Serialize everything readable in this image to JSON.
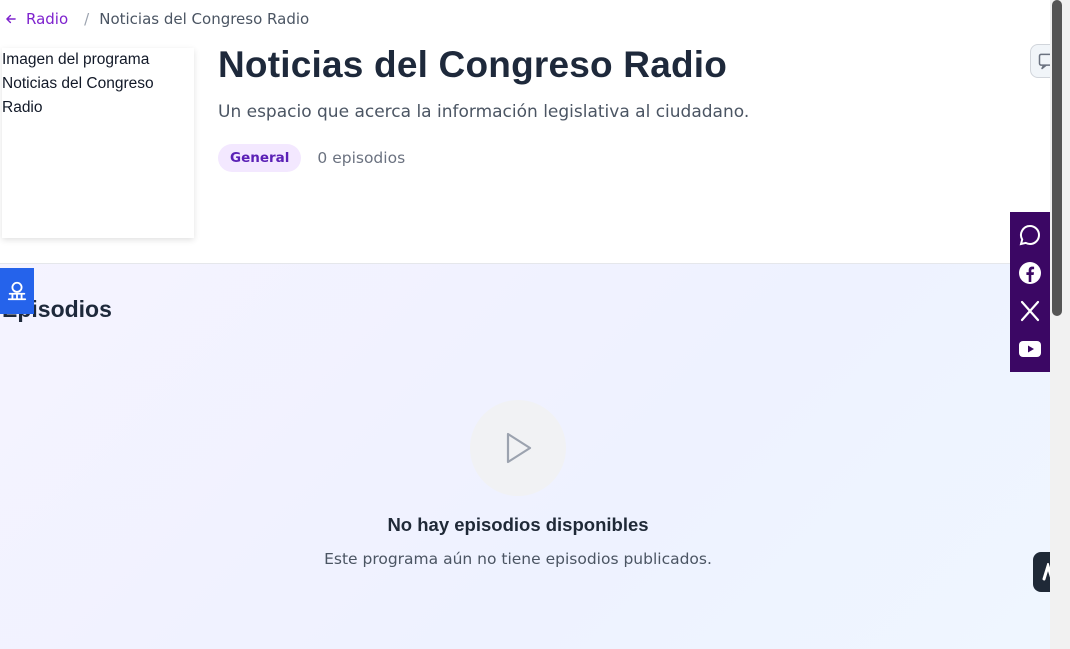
{
  "breadcrumb": {
    "back_label": "Radio",
    "back_icon": "arrow-left-icon",
    "separator": "/",
    "current": "Noticias del Congreso Radio"
  },
  "program": {
    "cover_alt": "Imagen del programa Noticias del Congreso Radio",
    "title": "Noticias del Congreso Radio",
    "description": "Un espacio que acerca la información legislativa al ciudadano.",
    "category": "General",
    "episode_count": "0 episodios"
  },
  "episodes": {
    "section_title": "Episodios",
    "empty_title": "No hay episodios disponibles",
    "empty_description": "Este programa aún no tiene episodios publicados."
  },
  "social": {
    "items": [
      "whatsapp-icon",
      "facebook-icon",
      "x-icon",
      "youtube-icon"
    ]
  },
  "colors": {
    "accent": "#7e22ce",
    "badge_bg": "#f3e8ff",
    "social_bg": "#3b0764",
    "a11y_bg": "#2563eb"
  }
}
